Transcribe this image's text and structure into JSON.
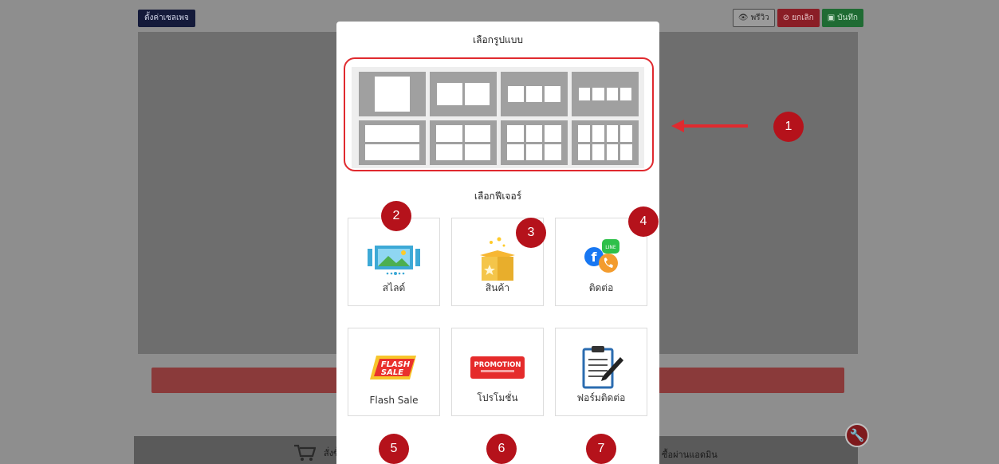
{
  "background": {
    "settings_button": "ตั้งค่าเซลเพจ",
    "preview_button": "พรีวิว",
    "cancel_button": "ยกเลิก",
    "save_button": "บันทึก",
    "order_label": "สั่งซื้อ",
    "admin_label": "ซื้อผ่านแอดมิน"
  },
  "modal": {
    "layout_title": "เลือกรูปแบบ",
    "feature_title": "เลือกฟีเจอร์",
    "layouts": [
      "1 column",
      "2 columns",
      "3 columns",
      "4 columns",
      "1 column x 2 rows",
      "2 columns x 2 rows",
      "3 columns x 2 rows",
      "4 columns x 2 rows"
    ],
    "features": [
      {
        "label": "สไลด์",
        "icon": "slider-icon"
      },
      {
        "label": "สินค้า",
        "icon": "product-box-icon"
      },
      {
        "label": "ติดต่อ",
        "icon": "contact-icon"
      },
      {
        "label": "Flash Sale",
        "icon": "flash-sale-icon"
      },
      {
        "label": "โปรโมชั่น",
        "icon": "promotion-icon"
      },
      {
        "label": "ฟอร์มติดต่อ",
        "icon": "contact-form-icon"
      }
    ],
    "promotion_badge": "PROMOTION",
    "flash_text": [
      "FLASH",
      "SALE"
    ]
  },
  "markers": [
    "1",
    "2",
    "3",
    "4",
    "5",
    "6",
    "7"
  ],
  "colors": {
    "marker": "#b5121b",
    "highlight_border": "#e02a2f",
    "arrow": "#e02a2f"
  }
}
